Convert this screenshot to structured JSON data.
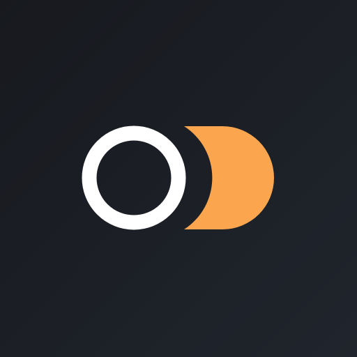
{
  "icon": {
    "name": "toggle-logo-icon",
    "colors": {
      "background_top_left": "#17191e",
      "background_bottom_right": "#20252d",
      "ring": "#ffffff",
      "half_disc": "#fba64f"
    }
  }
}
